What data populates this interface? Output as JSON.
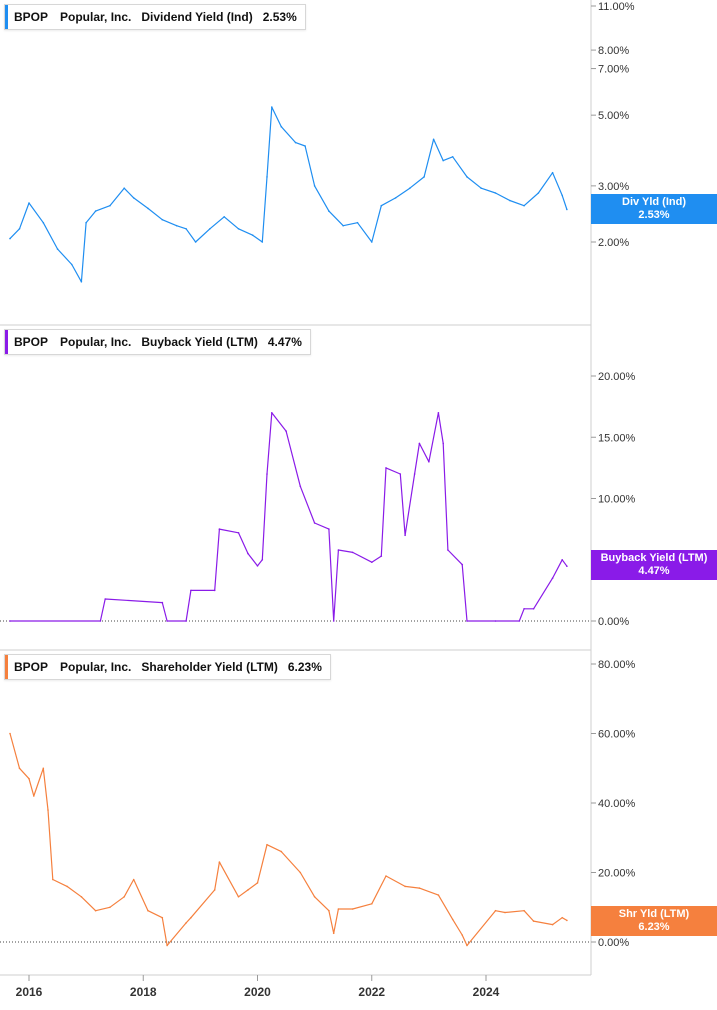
{
  "panels": [
    {
      "ticker": "BPOP",
      "company": "Popular, Inc.",
      "metric": "Dividend Yield (Ind)",
      "value": "2.53%",
      "tag_label": "Div Yld (Ind)",
      "tag_value": "2.53%",
      "color": "#1f8ef1",
      "scale": "log"
    },
    {
      "ticker": "BPOP",
      "company": "Popular, Inc.",
      "metric": "Buyback Yield (LTM)",
      "value": "4.47%",
      "tag_label": "Buyback Yield (LTM)",
      "tag_value": "4.47%",
      "color": "#8a1be8",
      "scale": "linear"
    },
    {
      "ticker": "BPOP",
      "company": "Popular, Inc.",
      "metric": "Shareholder Yield (LTM)",
      "value": "6.23%",
      "tag_label": "Shr Yld (LTM)",
      "tag_value": "6.23%",
      "color": "#f5803e",
      "scale": "linear"
    }
  ],
  "chart_data": [
    {
      "type": "line",
      "title": "BPOP Popular, Inc. Dividend Yield (Ind) 2.53%",
      "y_scale": "log",
      "ylim": [
        1.3,
        11.0
      ],
      "yticks": [
        2.0,
        3.0,
        5.0,
        7.0,
        8.0,
        11.0
      ],
      "ytick_labels": [
        "2.00%",
        "3.00%",
        "5.00%",
        "7.00%",
        "8.00%",
        "11.00%"
      ],
      "series": [
        {
          "name": "Div Yld (Ind)",
          "x": [
            "2015-09",
            "2015-11",
            "2016-01",
            "2016-04",
            "2016-07",
            "2016-10",
            "2016-12",
            "2017-01",
            "2017-03",
            "2017-06",
            "2017-09",
            "2017-11",
            "2018-02",
            "2018-05",
            "2018-08",
            "2018-10",
            "2018-12",
            "2019-03",
            "2019-06",
            "2019-09",
            "2019-12",
            "2020-02",
            "2020-03",
            "2020-04",
            "2020-06",
            "2020-09",
            "2020-11",
            "2021-01",
            "2021-04",
            "2021-07",
            "2021-10",
            "2022-01",
            "2022-03",
            "2022-06",
            "2022-09",
            "2022-12",
            "2023-02",
            "2023-04",
            "2023-06",
            "2023-09",
            "2023-12",
            "2024-03",
            "2024-06",
            "2024-09",
            "2024-12",
            "2025-03",
            "2025-05",
            "2025-06"
          ],
          "y": [
            2.05,
            2.2,
            2.65,
            2.3,
            1.9,
            1.7,
            1.5,
            2.3,
            2.5,
            2.6,
            2.95,
            2.75,
            2.55,
            2.35,
            2.25,
            2.2,
            2.0,
            2.2,
            2.4,
            2.2,
            2.1,
            2.0,
            3.2,
            5.3,
            4.6,
            4.1,
            4.0,
            3.0,
            2.5,
            2.25,
            2.3,
            2.0,
            2.6,
            2.75,
            2.95,
            3.2,
            4.2,
            3.6,
            3.7,
            3.2,
            2.95,
            2.85,
            2.7,
            2.6,
            2.85,
            3.3,
            2.8,
            2.53
          ]
        }
      ]
    },
    {
      "type": "line",
      "title": "BPOP Popular, Inc. Buyback Yield (LTM) 4.47%",
      "ylim": [
        0,
        20
      ],
      "yticks": [
        0,
        5,
        10,
        15,
        20
      ],
      "ytick_labels": [
        "0.00%",
        "5.00%",
        "10.00%",
        "15.00%",
        "20.00%"
      ],
      "series": [
        {
          "name": "Buyback Yield (LTM)",
          "x": [
            "2015-09",
            "2017-04",
            "2017-05",
            "2018-05",
            "2018-06",
            "2018-10",
            "2018-11",
            "2019-04",
            "2019-05",
            "2019-09",
            "2019-11",
            "2020-01",
            "2020-02",
            "2020-03",
            "2020-04",
            "2020-07",
            "2020-10",
            "2021-01",
            "2021-04",
            "2021-05",
            "2021-06",
            "2021-09",
            "2022-01",
            "2022-03",
            "2022-04",
            "2022-07",
            "2022-08",
            "2022-10",
            "2022-11",
            "2023-01",
            "2023-03",
            "2023-04",
            "2023-05",
            "2023-08",
            "2023-09",
            "2024-03",
            "2024-08",
            "2024-09",
            "2024-11",
            "2025-03",
            "2025-05",
            "2025-06"
          ],
          "y": [
            0.0,
            0.0,
            1.8,
            1.5,
            0.0,
            0.0,
            2.5,
            2.5,
            7.5,
            7.2,
            5.5,
            4.5,
            5.0,
            12.0,
            17.0,
            15.5,
            11.0,
            8.0,
            7.5,
            0.0,
            5.8,
            5.6,
            4.8,
            5.3,
            12.5,
            12.0,
            7.0,
            12.0,
            14.5,
            13.0,
            17.0,
            14.5,
            5.8,
            4.6,
            0.0,
            0.0,
            0.0,
            1.0,
            1.0,
            3.5,
            5.0,
            4.47
          ]
        }
      ]
    },
    {
      "type": "line",
      "title": "BPOP Popular, Inc. Shareholder Yield (LTM) 6.23%",
      "ylim": [
        -2,
        85
      ],
      "yticks": [
        0,
        20,
        40,
        60,
        80
      ],
      "ytick_labels": [
        "0.00%",
        "20.00%",
        "40.00%",
        "60.00%",
        "80.00%"
      ],
      "series": [
        {
          "name": "Shr Yld (LTM)",
          "x": [
            "2015-09",
            "2015-11",
            "2016-01",
            "2016-02",
            "2016-04",
            "2016-05",
            "2016-06",
            "2016-09",
            "2016-12",
            "2017-03",
            "2017-06",
            "2017-09",
            "2017-11",
            "2018-02",
            "2018-05",
            "2018-06",
            "2018-10",
            "2018-11",
            "2019-04",
            "2019-05",
            "2019-09",
            "2019-11",
            "2020-01",
            "2020-03",
            "2020-06",
            "2020-10",
            "2021-01",
            "2021-04",
            "2021-05",
            "2021-06",
            "2021-09",
            "2022-01",
            "2022-04",
            "2022-08",
            "2022-11",
            "2023-03",
            "2023-06",
            "2023-08",
            "2023-09",
            "2024-03",
            "2024-05",
            "2024-09",
            "2024-11",
            "2025-03",
            "2025-05",
            "2025-06"
          ],
          "y": [
            60.0,
            50.0,
            47.0,
            42.0,
            50.0,
            38.0,
            18.0,
            16.0,
            13.0,
            9.0,
            10.0,
            13.0,
            18.0,
            9.0,
            7.0,
            -1.0,
            5.5,
            7.0,
            15.0,
            23.0,
            13.0,
            15.0,
            17.0,
            28.0,
            26.0,
            20.0,
            13.0,
            9.0,
            2.5,
            9.5,
            9.5,
            11.0,
            19.0,
            16.0,
            15.5,
            13.5,
            6.5,
            2.0,
            -1.0,
            9.0,
            8.5,
            9.0,
            6.0,
            5.0,
            7.0,
            6.23
          ]
        }
      ]
    }
  ],
  "x_axis": {
    "ticks": [
      "2016",
      "2018",
      "2020",
      "2022",
      "2024"
    ]
  }
}
